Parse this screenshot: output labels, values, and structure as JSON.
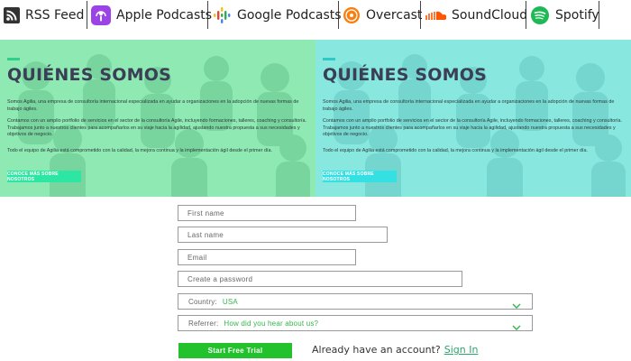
{
  "podcast_bar": {
    "items": [
      {
        "label": "RSS Feed",
        "icon": "rss-icon"
      },
      {
        "label": "Apple Podcasts",
        "icon": "apple-podcasts-icon"
      },
      {
        "label": "Google Podcasts",
        "icon": "google-podcasts-icon"
      },
      {
        "label": "Overcast",
        "icon": "overcast-icon"
      },
      {
        "label": "SoundCloud",
        "icon": "soundcloud-icon"
      },
      {
        "label": "Spotify",
        "icon": "spotify-icon"
      }
    ]
  },
  "hero": {
    "title": "QUIÉNES SOMOS",
    "paragraph1": "Somos Agilia, una empresa de consultoría internacional especializada en ayudar a organizaciones en la adopción de nuevas formas de trabajo ágiles.",
    "paragraph2": "Contamos con un amplio portfolio de servicios en el sector de la consultoría Agile, incluyendo formaciones, talleres, coaching y consultoría. Trabajamos junto a nuestros clientes para acompañarlos en su viaje hacia la agilidad, ajustando nuestra propuesta a sus necesidades y objetivos de negocio.",
    "paragraph3": "Todo el equipo de Agilia está comprometido con la calidad, la mejora continua y la implementación ágil desde el primer día.",
    "button": "CONOCE MÁS SOBRE NOSOTROS",
    "colors": {
      "left_tint": "#8fe9b3",
      "right_tint": "#88e7df"
    }
  },
  "form": {
    "first_name": "First name",
    "last_name": "Last name",
    "email": "Email",
    "password": "Create a password",
    "country_label": "Country:",
    "country_value": "USA",
    "referrer_label": "Referrer:",
    "referrer_value": "How did you hear about us?",
    "submit": "Start Free Trial",
    "already": "Already have an account?",
    "sign_in": "Sign In"
  },
  "colors": {
    "accent_green": "#22c22c",
    "link_green": "#2aa66b"
  }
}
